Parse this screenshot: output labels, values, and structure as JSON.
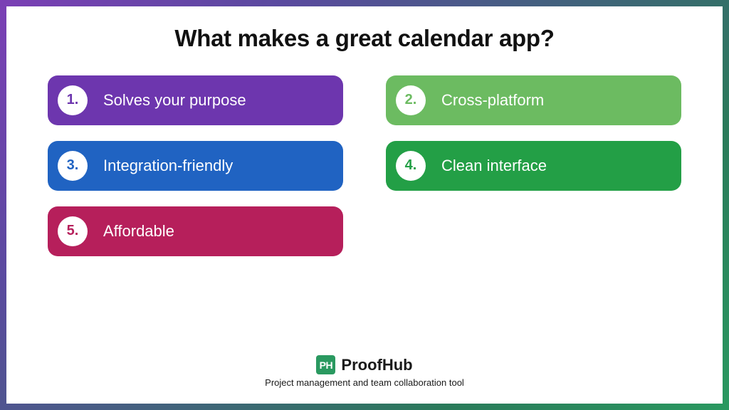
{
  "title": "What makes a great calendar app?",
  "items": [
    {
      "number": "1.",
      "label": "Solves your purpose"
    },
    {
      "number": "2.",
      "label": "Cross-platform"
    },
    {
      "number": "3.",
      "label": "Integration-friendly"
    },
    {
      "number": "4.",
      "label": "Clean interface"
    },
    {
      "number": "5.",
      "label": "Affordable"
    }
  ],
  "brand": {
    "icon_text": "PH",
    "name": "ProofHub",
    "tagline": "Project management and team collaboration tool"
  }
}
